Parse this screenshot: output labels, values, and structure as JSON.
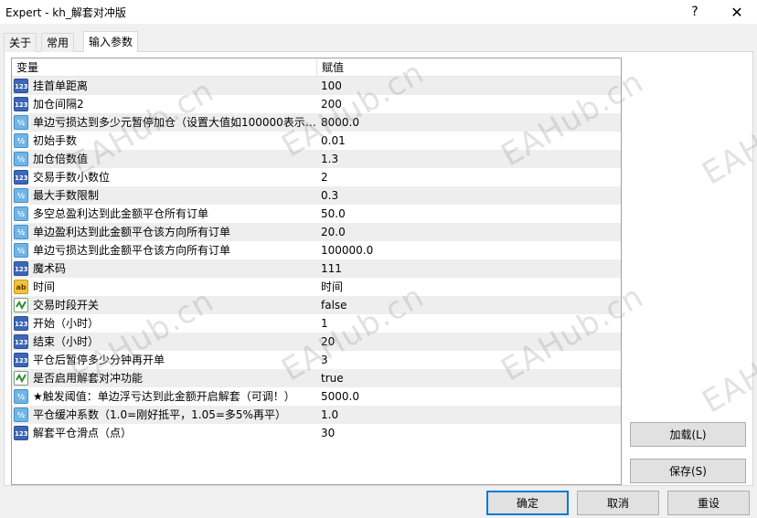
{
  "window": {
    "title": "Expert - kh_解套对冲版",
    "help_label": "?",
    "close_label": "✕"
  },
  "tabs": [
    {
      "label": "关于"
    },
    {
      "label": "常用"
    },
    {
      "label": "输入参数"
    }
  ],
  "grid": {
    "header_name": "变量",
    "header_value": "赋值",
    "rows": [
      {
        "type": "int",
        "name": "挂首单距离",
        "value": "100"
      },
      {
        "type": "int",
        "name": "加仓间隔2",
        "value": "200"
      },
      {
        "type": "double",
        "name": "单边亏损达到多少元暂停加仓（设置大值如100000表示?..",
        "value": "8000.0"
      },
      {
        "type": "double",
        "name": "初始手数",
        "value": "0.01"
      },
      {
        "type": "double",
        "name": "加仓倍数值",
        "value": "1.3"
      },
      {
        "type": "int",
        "name": "交易手数小数位",
        "value": "2"
      },
      {
        "type": "double",
        "name": "最大手数限制",
        "value": "0.3"
      },
      {
        "type": "double",
        "name": "多空总盈利达到此金额平仓所有订单",
        "value": "50.0"
      },
      {
        "type": "double",
        "name": "单边盈利达到此金额平仓该方向所有订单",
        "value": "20.0"
      },
      {
        "type": "double",
        "name": "单边亏损达到此金额平仓该方向所有订单",
        "value": "100000.0"
      },
      {
        "type": "int",
        "name": "魔术码",
        "value": "111"
      },
      {
        "type": "string",
        "name": "时间",
        "value": "时间"
      },
      {
        "type": "bool",
        "name": "交易时段开关",
        "value": "false"
      },
      {
        "type": "int",
        "name": "开始（小时）",
        "value": "1"
      },
      {
        "type": "int",
        "name": "结束（小时）",
        "value": "20"
      },
      {
        "type": "int",
        "name": "平仓后暂停多少分钟再开单",
        "value": "3"
      },
      {
        "type": "bool",
        "name": "是否启用解套对冲功能",
        "value": "true"
      },
      {
        "type": "double",
        "name": "★触发阈值：单边浮亏达到此金额开启解套（可调！）",
        "value": "5000.0"
      },
      {
        "type": "double",
        "name": "平仓缓冲系数（1.0=刚好抵平，1.05=多5%再平）",
        "value": "1.0"
      },
      {
        "type": "int",
        "name": "解套平仓滑点（点）",
        "value": "30"
      }
    ]
  },
  "icons": {
    "int": "123",
    "double": "½",
    "string": "ab",
    "bool": "bool-check-icon"
  },
  "side_buttons": {
    "load_label": "加载(L)",
    "save_label": "保存(S)"
  },
  "footer_buttons": {
    "ok_label": "确定",
    "cancel_label": "取消",
    "reset_label": "重设"
  },
  "watermark": "EAHub.cn",
  "colors": {
    "accent": "#0078d7",
    "row_alt": "#eeeeee"
  }
}
